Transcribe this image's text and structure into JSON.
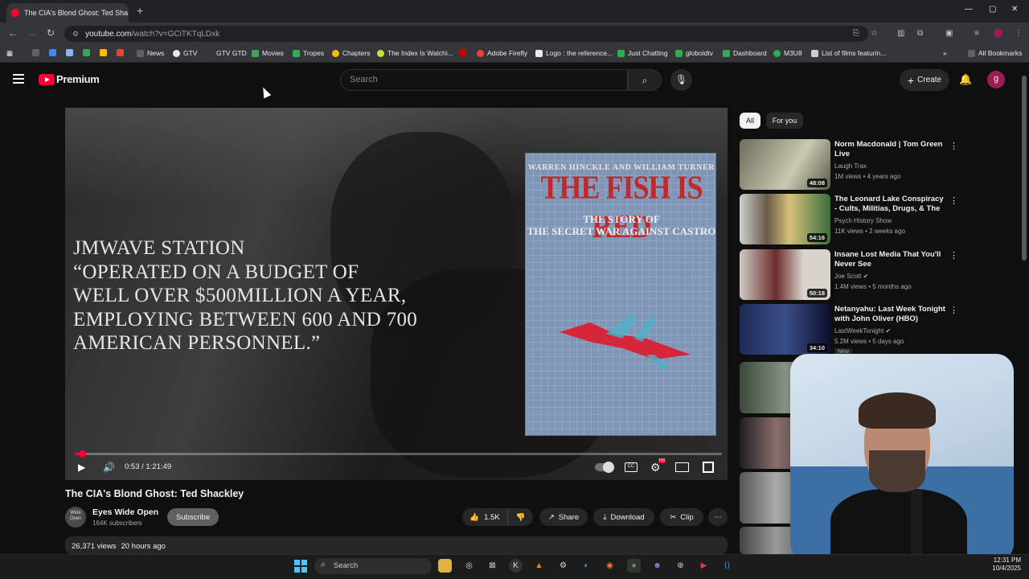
{
  "browser": {
    "tab_title": "The CIA's Blond Ghost: Ted Sha",
    "tab_close": "✕",
    "new_tab": "+",
    "url_domain": "youtube.com",
    "url_path": "/watch?v=GCiTKTqLDxk",
    "bookmarks": [
      "News",
      "GTV",
      "GTV GTD",
      "Movies",
      "Tropes",
      "Chapters",
      "The Index Is Watchi...",
      "Adobe Firefly",
      "Logo : the reference...",
      "Just Chatting",
      "globoidtv",
      "Dashboard",
      "M3U8",
      "List of films featurin..."
    ],
    "all_bookmarks": "All Bookmarks",
    "bookmark_colors": [
      "#5f6368",
      "#4285f4",
      "#8ab4f8",
      "#34a853",
      "#fbbc04",
      "#ea4335",
      "#81c995",
      "#5f6368",
      "#34a853",
      "#34a853",
      "#fbbc04",
      "#cc0000",
      "#ea4335",
      "#5f6368",
      "#34a853",
      "#34a853",
      "#34a853",
      "#34a853",
      "#cccccc"
    ]
  },
  "youtube": {
    "brand": "Premium",
    "search_placeholder": "Search",
    "create_label": "Create",
    "avatar_letter": "g"
  },
  "video": {
    "overlay_lines": [
      "JMWAVE Station",
      "“Operated on a budget of",
      "well over $500million a year,",
      "employing between 600 and 700",
      "American personnel.”"
    ],
    "book_authors": "WARREN HINCKLE AND WILLIAM TURNER",
    "book_title": "THE FISH IS RED",
    "book_subtitle_1": "THE STORY OF",
    "book_subtitle_2": "THE SECRET WAR AGAINST CASTRO",
    "time": "0:53 / 1:21:49",
    "progress_fraction": 0.011,
    "hd_badge": "HD",
    "cc_label": "CC",
    "title": "The CIA's Blond Ghost: Ted Shackley",
    "channel": "Eyes Wide Open",
    "channel_avatar_text": "Wide Open",
    "subscribers": "164K subscribers",
    "subscribe_label": "Subscribe",
    "likes": "1.5K",
    "share_label": "Share",
    "download_label": "Download",
    "clip_label": "Clip",
    "views": "26,371 views",
    "age": "20 hours ago"
  },
  "sidebar": {
    "chips": [
      "All",
      "For you"
    ],
    "items": [
      {
        "title": "Norm Macdonald | Tom Green Live",
        "channel": "Laugh Trax",
        "meta": "1M views • 4 years ago",
        "duration": "48:08"
      },
      {
        "title": "The Leonard Lake Conspiracy - Cults, Militias, Drugs, & The ...",
        "channel": "Psych History Show",
        "meta": "11K views • 2 weeks ago",
        "duration": "54:16"
      },
      {
        "title": "Insane Lost Media That You'll Never See",
        "channel": "Joe Scott",
        "meta": "1.4M views • 5 months ago",
        "duration": "50:18"
      },
      {
        "title": "Netanyahu: Last Week Tonight with John Oliver (HBO)",
        "channel": "LastWeekTonight",
        "meta": "5.2M views • 5 days ago",
        "duration": "34:10"
      }
    ],
    "new_badge": "New"
  },
  "taskbar": {
    "search_label": "Search",
    "time": "12:31 PM",
    "date": "10/4/2025"
  }
}
